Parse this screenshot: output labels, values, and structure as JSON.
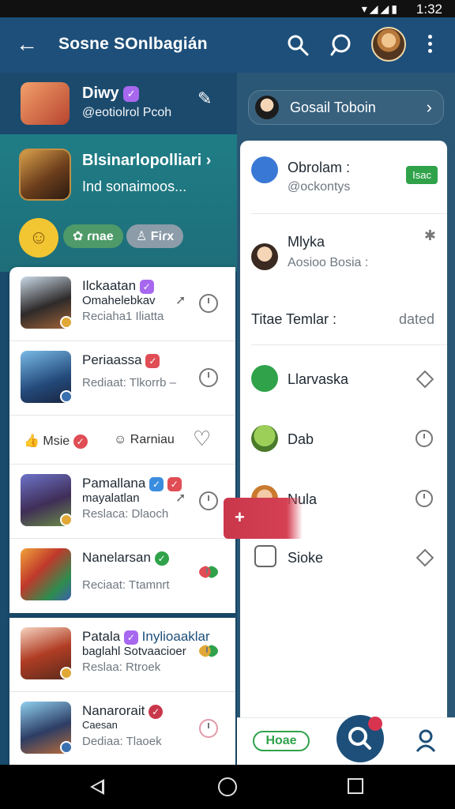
{
  "status": {
    "time": "1:32",
    "icons": "▾◢◢▮"
  },
  "appbar": {
    "title": "Sosne SOnlbagián",
    "back_glyph": "←"
  },
  "profile": {
    "name": "Diwy",
    "handle": "@eotiolrol Pcoh",
    "badge": "✓",
    "edit_glyph": "✎"
  },
  "group": {
    "name": "Blsinarlopolliari",
    "name_suffix": "›",
    "desc": "Ind sonaimoos...",
    "chip1": "✿ ɾnae",
    "chip2": "♙ Fiɾx",
    "emoji": "☺"
  },
  "list": {
    "items": [
      {
        "title": "Ilckaatan",
        "subtitle": "Omahelebkav",
        "meta": "Reciaha1 Iliatta",
        "badge_color": "#a768ef",
        "thumb": "linear-gradient(160deg,#c9d9e6,#2e2a2a 55%,#a16438)"
      },
      {
        "title": "Periaassa",
        "subtitle": "",
        "meta": "Rediaat: Tlkorrb –",
        "badge_color": "#e04d55",
        "thumb": "linear-gradient(160deg,#79b9e6,#234a7a 60%,#1a2440)"
      },
      {
        "title": "Pamallana",
        "subtitle": "mayalatlan",
        "meta": "Reslaca: Dlaoch",
        "badge_color": "#3a8dde",
        "thumb": "linear-gradient(160deg,#6d73c9,#3f2e58 55%,#6a8b45)"
      },
      {
        "title": "Nanelarsan",
        "subtitle": "",
        "meta": "Reciaat: Ttamnrt",
        "badge_color": "#2fa24a",
        "thumb": "linear-gradient(135deg,#f0a23b,#c0392b 40%,#2e8d4e 75%,#3d5fae)"
      }
    ],
    "actions": {
      "like": "Msie",
      "react": "Rarniau",
      "heart": "♡"
    }
  },
  "list2": {
    "items": [
      {
        "title": "Patala",
        "title_extra": "Inylioaaklar",
        "subtitle": "baglahl Sotvaacioer",
        "meta": "Reslaa: Rtroek",
        "thumb": "linear-gradient(160deg,#f6d3c0,#b03d24 50%,#5a2a1c)"
      },
      {
        "title": "Nanarorait",
        "subtitle": "Caesan",
        "meta": "Dediaa: Tlaoek",
        "thumb": "linear-gradient(160deg,#8fd0f0,#2d3d64 55%,#b76b3a)"
      }
    ]
  },
  "right": {
    "pill": {
      "label": "Gosail Toboin",
      "chevron": "›"
    },
    "items": [
      {
        "name": "Obrolam :",
        "sub": "@ockontys",
        "tag": "Isac"
      },
      {
        "name": "Mlyka",
        "sub": "Aosioo Bosia :"
      },
      {
        "section": "Titae Temlar :",
        "section_tag": "dated"
      },
      {
        "name": "Llarvaska"
      },
      {
        "name": "Dab"
      },
      {
        "name": "Nula"
      },
      {
        "name": "Sioke"
      }
    ],
    "fab": "+"
  },
  "bottom": {
    "home_label": "Hoae"
  },
  "colors": {
    "primary": "#1d4f7a",
    "accent_green": "#2fa24a",
    "accent_red": "#d8344f",
    "purple": "#a768ef"
  }
}
